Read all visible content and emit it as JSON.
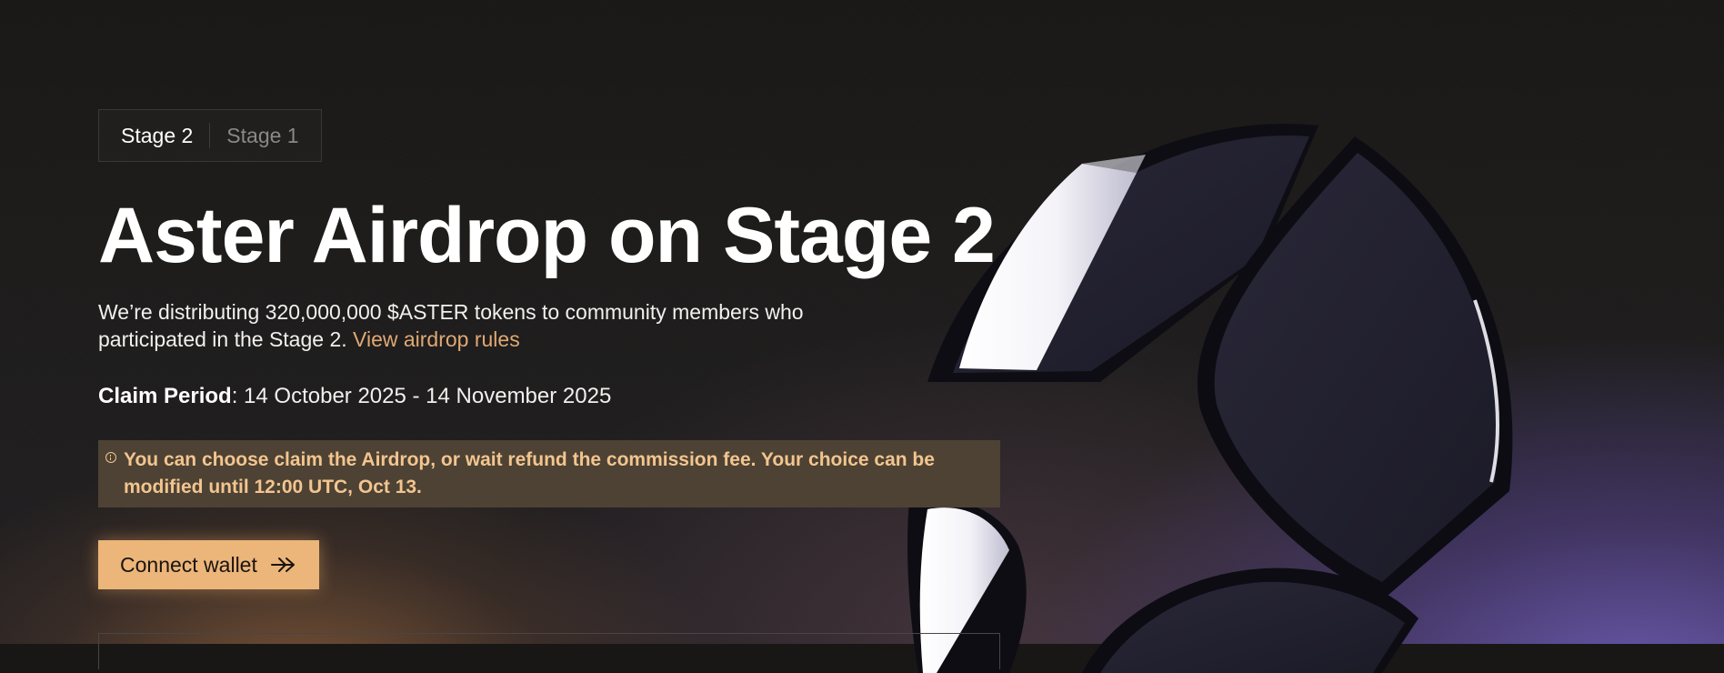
{
  "stages": {
    "tabs": [
      {
        "label": "Stage 2",
        "active": true
      },
      {
        "label": "Stage 1",
        "active": false
      }
    ]
  },
  "hero": {
    "title": "Aster Airdrop on Stage 2",
    "description": "We’re distributing 320,000,000 $ASTER tokens to community members who participated in the Stage 2.",
    "rules_link": "View airdrop rules",
    "claim_label": "Claim Period",
    "claim_value": ": 14 October 2025 - 14 November 2025",
    "notice": "You can choose claim the Airdrop, or wait refund the commission fee. Your choice can be modified until 12:00 UTC, Oct 13.",
    "notice_icon": "info-icon",
    "connect_label": "Connect wallet",
    "connect_icon": "arrow-right-icon"
  },
  "colors": {
    "accent": "#ecb57a",
    "link": "#e0a874",
    "notice_bg": "#4d4234",
    "notice_text": "#f3c58f"
  }
}
